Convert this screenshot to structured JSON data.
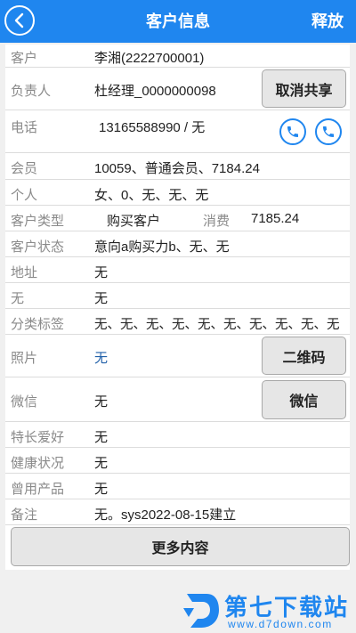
{
  "header": {
    "title": "客户信息",
    "action_label": "释放"
  },
  "rows": {
    "customer": {
      "label": "客户",
      "value": "李湘(2222700001)"
    },
    "owner": {
      "label": "负责人",
      "value": "杜经理_0000000098",
      "button": "取消共享"
    },
    "phone": {
      "label": "电话",
      "value": "13165588990 / 无"
    },
    "member": {
      "label": "会员",
      "value": "10059、普通会员、7184.24"
    },
    "personal": {
      "label": "个人",
      "value": "女、0、无、无、无"
    },
    "customer_type": {
      "label": "客户类型",
      "value": "购买客户",
      "consume_label": "消费",
      "consume_value": "7185.24"
    },
    "customer_status": {
      "label": "客户状态",
      "value": "意向a购买力b、无、无"
    },
    "address": {
      "label": "地址",
      "value": "无"
    },
    "none_field": {
      "label": "无",
      "value": "无"
    },
    "tags": {
      "label": "分类标签",
      "value": "无、无、无、无、无、无、无、无、无、无"
    },
    "photo": {
      "label": "照片",
      "value": "无",
      "button": "二维码"
    },
    "wechat": {
      "label": "微信",
      "value": "无",
      "button": "微信"
    },
    "hobby": {
      "label": "特长爱好",
      "value": "无"
    },
    "health": {
      "label": "健康状况",
      "value": "无"
    },
    "used_products": {
      "label": "曾用产品",
      "value": "无"
    },
    "remark": {
      "label": "备注",
      "value": "无。sys2022-08-15建立"
    }
  },
  "more_button": "更多内容",
  "watermark": {
    "brand": "第七下载站",
    "url": "www.d7down.com"
  },
  "colors": {
    "header_bg": "#1f86ef",
    "link": "#1f5fa8",
    "label": "#8a8a8a"
  },
  "icons": {
    "back": "chevron-left-icon",
    "phone": "phone-icon"
  }
}
